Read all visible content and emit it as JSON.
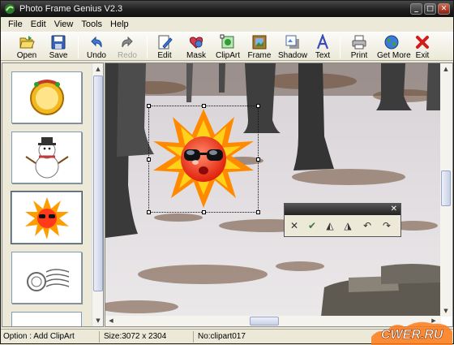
{
  "window": {
    "title": "Photo Frame Genius V2.3"
  },
  "title_buttons": {
    "minimize": "_",
    "maximize": "□",
    "close": "✕"
  },
  "menu": [
    "File",
    "Edit",
    "View",
    "Tools",
    "Help"
  ],
  "toolbar": {
    "open": "Open",
    "save": "Save",
    "undo": "Undo",
    "redo": "Redo",
    "edit": "Edit",
    "mask": "Mask",
    "clipart": "ClipArt",
    "frame": "Frame",
    "shadow": "Shadow",
    "text": "Text",
    "print": "Print",
    "get_more": "Get More",
    "exit": "Exit"
  },
  "thumbnails": [
    {
      "icon": "ornate-round-frame-icon"
    },
    {
      "icon": "snowman-clipart-icon"
    },
    {
      "icon": "sun-with-sunglasses-clipart-icon",
      "selected": true
    },
    {
      "icon": "postmark-stamp-clipart-icon"
    },
    {
      "icon": "blank-clipart-icon"
    }
  ],
  "floating_toolbar": {
    "close": "✕",
    "delete": "✕",
    "apply": "✔",
    "flip_horizontal": "◭",
    "flip_vertical": "◮",
    "rotate_left": "↶",
    "rotate_right": "↷"
  },
  "status": {
    "option": "Option : Add ClipArt",
    "size": "Size:3072 x 2304",
    "name": "No:clipart017"
  },
  "watermark": "CWER.RU",
  "colors": {
    "title_bar": "#1e1e1e",
    "window_bg": "#ece9d8",
    "snow": "#e8e6e8",
    "sun": "#ff9c00"
  }
}
